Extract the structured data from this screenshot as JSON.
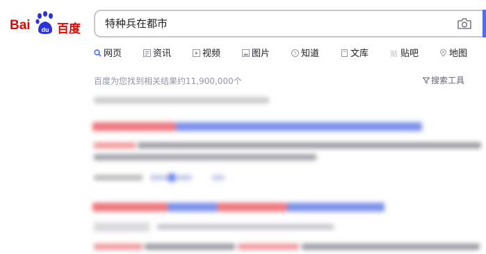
{
  "brand": {
    "logo_text": "Bai du 百度",
    "logo_bai": "Bai",
    "logo_du": "du",
    "logo_cn": "百度",
    "red": "#e10601",
    "blue": "#2932e1"
  },
  "search": {
    "value": "特种兵在都市",
    "icon": "camera-icon",
    "accent": "#4e6ef2"
  },
  "tabs": [
    {
      "label": "网页",
      "icon": "search-icon",
      "active": true
    },
    {
      "label": "资讯",
      "icon": "news-icon"
    },
    {
      "label": "视频",
      "icon": "video-icon"
    },
    {
      "label": "图片",
      "icon": "image-icon"
    },
    {
      "label": "知道",
      "icon": "question-icon"
    },
    {
      "label": "文库",
      "icon": "document-icon"
    },
    {
      "label": "贴吧",
      "icon": "tieba-icon"
    },
    {
      "label": "地图",
      "icon": "map-icon"
    }
  ],
  "results_info": {
    "count_text": "百度为您找到相关结果约11,900,000个",
    "tools_label": "搜索工具",
    "tools_icon": "filter-icon"
  }
}
